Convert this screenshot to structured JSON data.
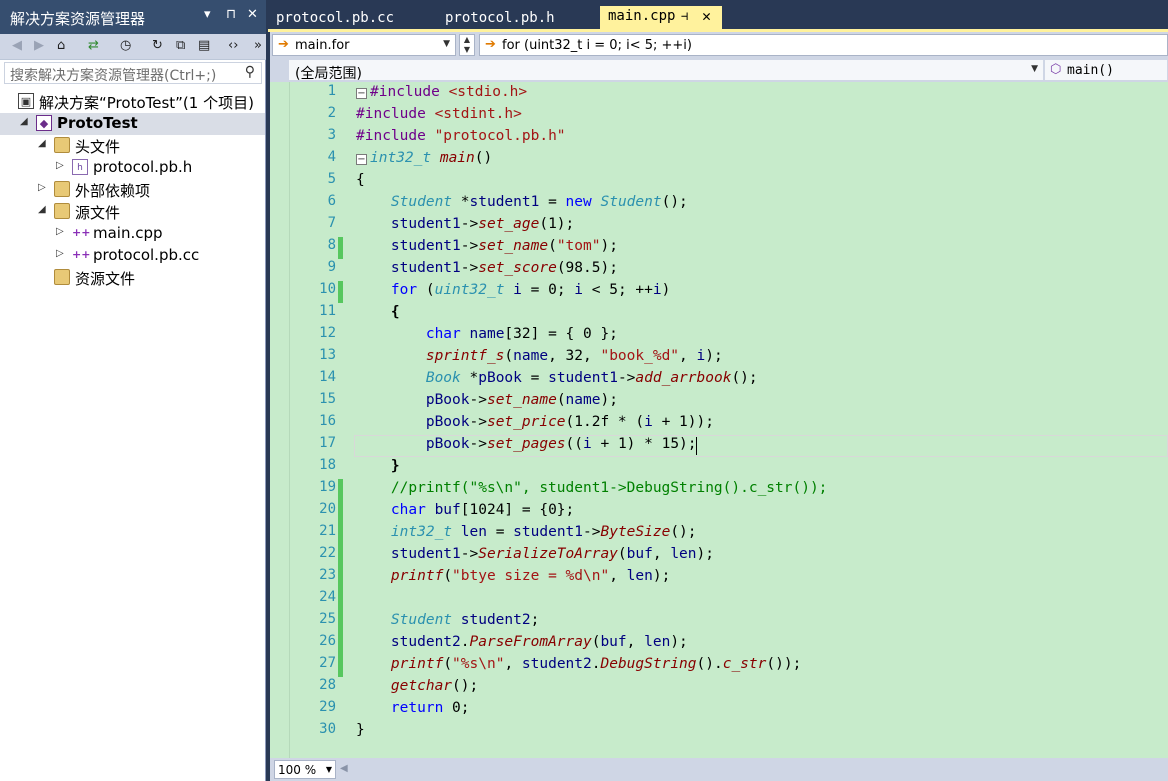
{
  "solution_explorer": {
    "title": "解决方案资源管理器",
    "title_controls": [
      "▾",
      "⊓",
      "✕"
    ],
    "search_placeholder": "搜索解决方案资源管理器(Ctrl+;)",
    "tree": [
      {
        "label": "解决方案“ProtoTest”(1 个项目)",
        "icon": "solution-icon",
        "depth": 0,
        "arrow": "",
        "selected": false,
        "bold": false
      },
      {
        "label": "ProtoTest",
        "icon": "project-icon",
        "depth": 1,
        "arrow": "◢",
        "selected": true,
        "bold": true
      },
      {
        "label": "头文件",
        "icon": "folder-icon",
        "depth": 2,
        "arrow": "◢",
        "selected": false,
        "bold": false
      },
      {
        "label": "protocol.pb.h",
        "icon": "header-file-icon",
        "depth": 3,
        "arrow": "▷",
        "selected": false,
        "bold": false
      },
      {
        "label": "外部依赖项",
        "icon": "folder-icon",
        "depth": 2,
        "arrow": "▷",
        "selected": false,
        "bold": false
      },
      {
        "label": "源文件",
        "icon": "folder-icon",
        "depth": 2,
        "arrow": "◢",
        "selected": false,
        "bold": false
      },
      {
        "label": "main.cpp",
        "icon": "cpp-file-icon",
        "depth": 3,
        "arrow": "▷",
        "selected": false,
        "bold": false
      },
      {
        "label": "protocol.pb.cc",
        "icon": "cpp-file-icon",
        "depth": 3,
        "arrow": "▷",
        "selected": false,
        "bold": false
      },
      {
        "label": "资源文件",
        "icon": "folder-icon",
        "depth": 2,
        "arrow": "",
        "selected": false,
        "bold": false
      }
    ]
  },
  "tabs": [
    {
      "label": "protocol.pb.cc",
      "active": false
    },
    {
      "label": "protocol.pb.h",
      "active": false
    },
    {
      "label": "main.cpp",
      "active": true
    }
  ],
  "navbar": {
    "scope_combo": "main.for",
    "member_combo": "for (uint32_t i = 0; i< 5; ++i)",
    "global_scope": "(全局范围)",
    "function_combo": "main()"
  },
  "editor": {
    "current_line": 17,
    "changed_lines": [
      8,
      10,
      19,
      20,
      21,
      22,
      23,
      24,
      25,
      26,
      27
    ],
    "lines": [
      "#include <stdio.h>",
      "#include <stdint.h>",
      "#include \"protocol.pb.h\"",
      "int32_t main()",
      "{",
      "    Student *student1 = new Student();",
      "    student1->set_age(1);",
      "    student1->set_name(\"tom\");",
      "    student1->set_score(98.5);",
      "    for (uint32_t i = 0; i < 5; ++i)",
      "    {",
      "        char name[32] = { 0 };",
      "        sprintf_s(name, 32, \"book_%d\", i);",
      "        Book *pBook = student1->add_arrbook();",
      "        pBook->set_name(name);",
      "        pBook->set_price(1.2f * (i + 1));",
      "        pBook->set_pages((i + 1) * 15);",
      "    }",
      "    //printf(\"%s\\n\", student1->DebugString().c_str());",
      "    char buf[1024] = {0};",
      "    int32_t len = student1->ByteSize();",
      "    student1->SerializeToArray(buf, len);",
      "    printf(\"btye size = %d\\n\", len);",
      "",
      "    Student student2;",
      "    student2.ParseFromArray(buf, len);",
      "    printf(\"%s\\n\", student2.DebugString().c_str());",
      "    getchar();",
      "    return 0;",
      "}"
    ]
  },
  "zoom": "100 %",
  "colors": {
    "editor_bg": "#c7ebcb",
    "active_tab": "#fff29d",
    "title_bar": "#364e6f",
    "change_marker": "#57c75f"
  }
}
